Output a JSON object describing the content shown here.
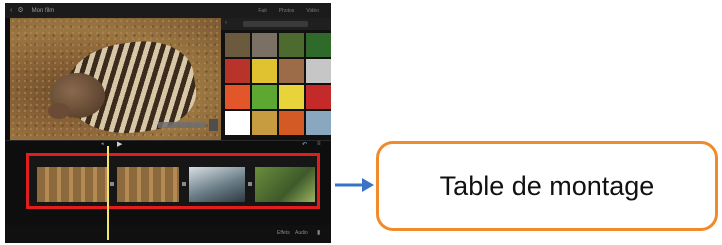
{
  "app": {
    "title": "Mon film",
    "top_tabs": [
      "Fait",
      "Photos",
      "Vidéo"
    ],
    "preview_caption": "",
    "bottom_left": "",
    "bottom_right": [
      "Effets",
      "Audio"
    ]
  },
  "browser": {
    "header_label": "",
    "thumbnail_colors": [
      "#6b5a3d",
      "#7a7064",
      "#4d6b2f",
      "#2f6a2a",
      "#b8332a",
      "#e0c12f",
      "#9b6c47",
      "#c6c6c6",
      "#e2562a",
      "#5da830",
      "#e8d43a",
      "#c42a2a",
      "#ffffff",
      "#c79b3f",
      "#d45a25",
      "#8aa7c0"
    ]
  },
  "timeline": {
    "clips": [
      "grass",
      "grass",
      "bird",
      "green"
    ],
    "accent": "#e11d1d",
    "cursor_color": "#f2e66a"
  },
  "callout": {
    "label": "Table de montage",
    "border_color": "#f08a2a",
    "arrow_color": "#3a73c4"
  }
}
